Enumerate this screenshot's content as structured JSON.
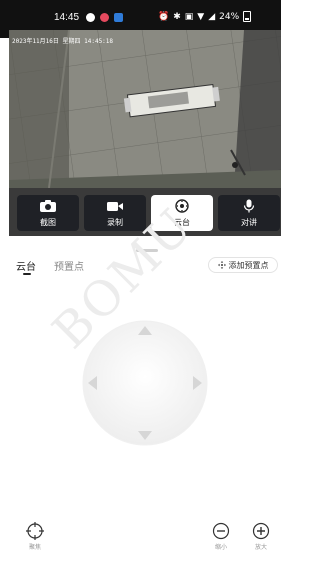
{
  "status_bar": {
    "time": "14:45",
    "battery": "24%",
    "colors": {
      "red_dot": "#e64a5f",
      "blue_dot": "#2f7bd8"
    }
  },
  "video": {
    "osd_text": "2023年11月16日 星期四 14:45:18"
  },
  "toolbar": {
    "items": [
      {
        "label": "截图",
        "icon": "camera-icon"
      },
      {
        "label": "录制",
        "icon": "video-camera-icon"
      },
      {
        "label": "云台",
        "icon": "ptz-icon",
        "active": true
      },
      {
        "label": "对讲",
        "icon": "microphone-icon"
      }
    ]
  },
  "tabs": [
    {
      "label": "云台",
      "active": true
    },
    {
      "label": "预置点",
      "active": false
    }
  ],
  "add_preset": {
    "label": "添加预置点",
    "icon": "move-icon"
  },
  "watermark": "BOMU",
  "bottom_controls": {
    "focus": {
      "label": "聚焦",
      "icon": "focus-target-icon"
    },
    "zoom_out": {
      "label": "缩小",
      "icon": "minus-circle-icon"
    },
    "zoom_in": {
      "label": "放大",
      "icon": "plus-circle-icon"
    }
  }
}
